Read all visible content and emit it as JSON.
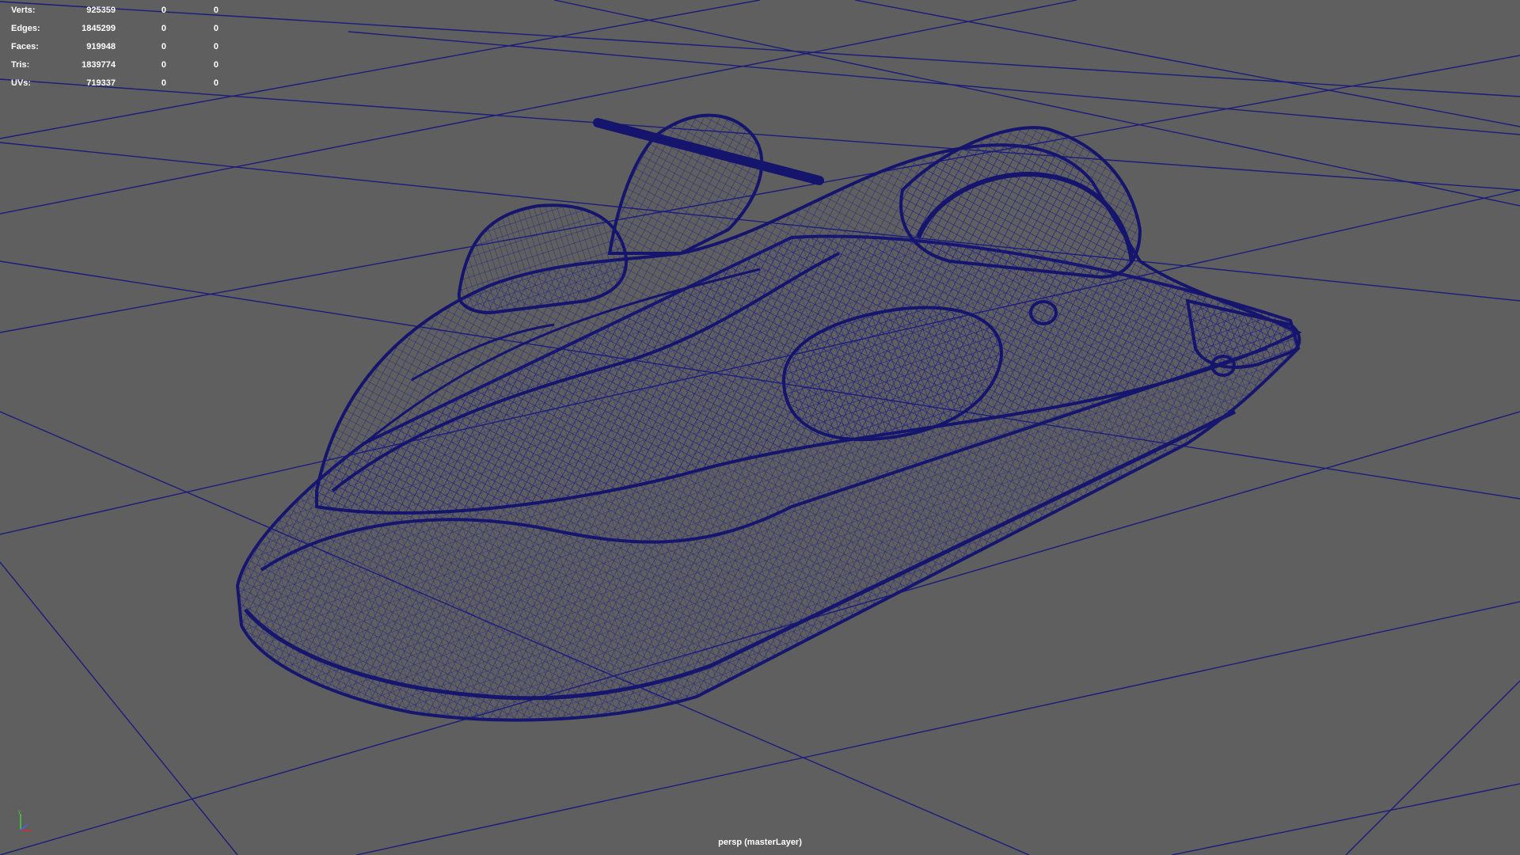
{
  "hud": {
    "rows": [
      {
        "label": "Verts:",
        "total": "925359",
        "selected": "0",
        "components": "0"
      },
      {
        "label": "Edges:",
        "total": "1845299",
        "selected": "0",
        "components": "0"
      },
      {
        "label": "Faces:",
        "total": "919948",
        "selected": "0",
        "components": "0"
      },
      {
        "label": "Tris:",
        "total": "1839774",
        "selected": "0",
        "components": "0"
      },
      {
        "label": "UVs:",
        "total": "719337",
        "selected": "0",
        "components": "0"
      }
    ]
  },
  "viewport": {
    "camera_label": "persp (masterLayer)",
    "background_color": "#5f5f5f",
    "grid_color": "#1c1c7a",
    "wireframe_color": "#14147a"
  },
  "gizmo": {
    "x_color": "#d03030",
    "y_color": "#40d040",
    "z_color": "#4060ff",
    "icon": "axis-gizmo-icon"
  }
}
